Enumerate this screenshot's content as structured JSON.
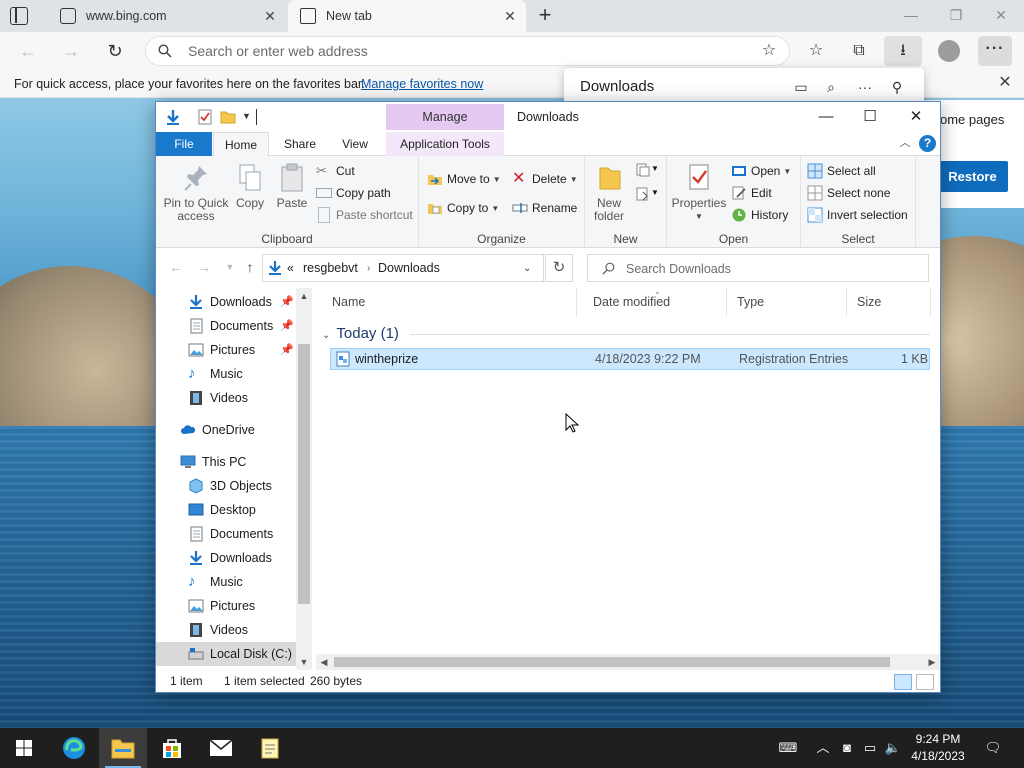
{
  "browser": {
    "tabs": [
      {
        "title": "www.bing.com"
      },
      {
        "title": "New tab"
      }
    ],
    "address_placeholder": "Search or enter web address",
    "favbar": {
      "message": "For quick access, place your favorites here on the favorites bar.",
      "link": "Manage favorites now"
    },
    "downloads_panel": {
      "title": "Downloads"
    },
    "ntp": {
      "card_text": "ome pages",
      "restore_label": "Restore"
    }
  },
  "explorer": {
    "title": "Downloads",
    "manage_label": "Manage",
    "ribbon_tabs": {
      "file": "File",
      "home": "Home",
      "share": "Share",
      "view": "View",
      "app_tools": "Application Tools"
    },
    "ribbon": {
      "clipboard": {
        "label": "Clipboard",
        "pin": "Pin to Quick access",
        "pin_line1": "Pin to Quick",
        "pin_line2": "access",
        "copy": "Copy",
        "paste": "Paste",
        "cut": "Cut",
        "copy_path": "Copy path",
        "paste_shortcut": "Paste shortcut"
      },
      "organize": {
        "label": "Organize",
        "move_to": "Move to",
        "copy_to": "Copy to",
        "delete": "Delete",
        "rename": "Rename"
      },
      "new": {
        "label": "New",
        "new_folder_1": "New",
        "new_folder_2": "folder"
      },
      "open": {
        "label": "Open",
        "properties": "Properties",
        "open": "Open",
        "edit": "Edit",
        "history": "History"
      },
      "select": {
        "label": "Select",
        "select_all": "Select all",
        "select_none": "Select none",
        "invert": "Invert selection"
      }
    },
    "address": {
      "overflow": "«",
      "crumbs": [
        "resgbebvt",
        "Downloads"
      ]
    },
    "search_placeholder": "Search Downloads",
    "nav": {
      "quick": [
        {
          "label": "Downloads",
          "pinned": true
        },
        {
          "label": "Documents",
          "pinned": true
        },
        {
          "label": "Pictures",
          "pinned": true
        },
        {
          "label": "Music",
          "pinned": false
        },
        {
          "label": "Videos",
          "pinned": false
        }
      ],
      "onedrive": "OneDrive",
      "this_pc": "This PC",
      "pc_items": [
        "3D Objects",
        "Desktop",
        "Documents",
        "Downloads",
        "Music",
        "Pictures",
        "Videos",
        "Local Disk (C:)"
      ]
    },
    "columns": {
      "name": "Name",
      "date": "Date modified",
      "type": "Type",
      "size": "Size"
    },
    "group": "Today (1)",
    "file": {
      "name": "wintheprize",
      "date": "4/18/2023 9:22 PM",
      "type": "Registration Entries",
      "size": "1 KB"
    },
    "status": {
      "items": "1 item",
      "selected": "1 item selected",
      "bytes": "260 bytes"
    }
  },
  "taskbar": {
    "time": "9:24 PM",
    "date": "4/18/2023"
  },
  "colors": {
    "accent": "#1979ca",
    "manage": "#e5c9f2",
    "selection": "#cce8ff",
    "taskbar": "#1f1f1f"
  }
}
